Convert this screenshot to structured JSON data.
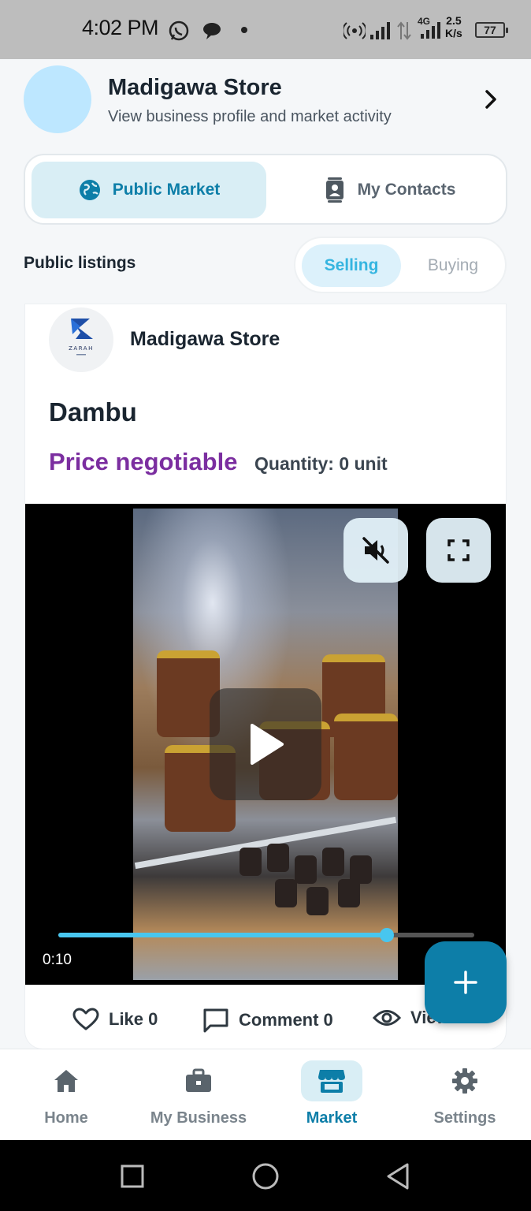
{
  "status_bar": {
    "time": "4:02 PM",
    "network": "4G",
    "speed_value": "2.5",
    "speed_unit": "K/s",
    "battery": "77"
  },
  "header": {
    "store_name": "Madigawa Store",
    "subtitle": "View business profile and market activity"
  },
  "market_tabs": [
    {
      "label": "Public Market",
      "icon": "globe-icon",
      "active": true
    },
    {
      "label": "My Contacts",
      "icon": "contacts-icon",
      "active": false
    }
  ],
  "listings": {
    "title": "Public listings",
    "toggle": [
      {
        "label": "Selling",
        "active": true
      },
      {
        "label": "Buying",
        "active": false
      }
    ]
  },
  "listing_card": {
    "seller_name": "Madigawa Store",
    "seller_logo_text": "ZARAH",
    "product_title": "Dambu",
    "price": "Price negotiable",
    "quantity": "Quantity: 0 unit",
    "video": {
      "time": "0:10",
      "progress": 0.79,
      "muted": true
    },
    "actions": {
      "like": "Like 0",
      "comment": "Comment 0",
      "view": "View 5"
    }
  },
  "bottom_nav": [
    {
      "label": "Home",
      "icon": "home-icon",
      "active": false
    },
    {
      "label": "My Business",
      "icon": "briefcase-icon",
      "active": false
    },
    {
      "label": "Market",
      "icon": "store-icon",
      "active": true
    },
    {
      "label": "Settings",
      "icon": "gear-icon",
      "active": false
    }
  ],
  "colors": {
    "accent": "#0d7ea8",
    "price": "#7b2ea0",
    "tab_active_bg": "#d9eef5",
    "progress": "#48c6ef"
  }
}
